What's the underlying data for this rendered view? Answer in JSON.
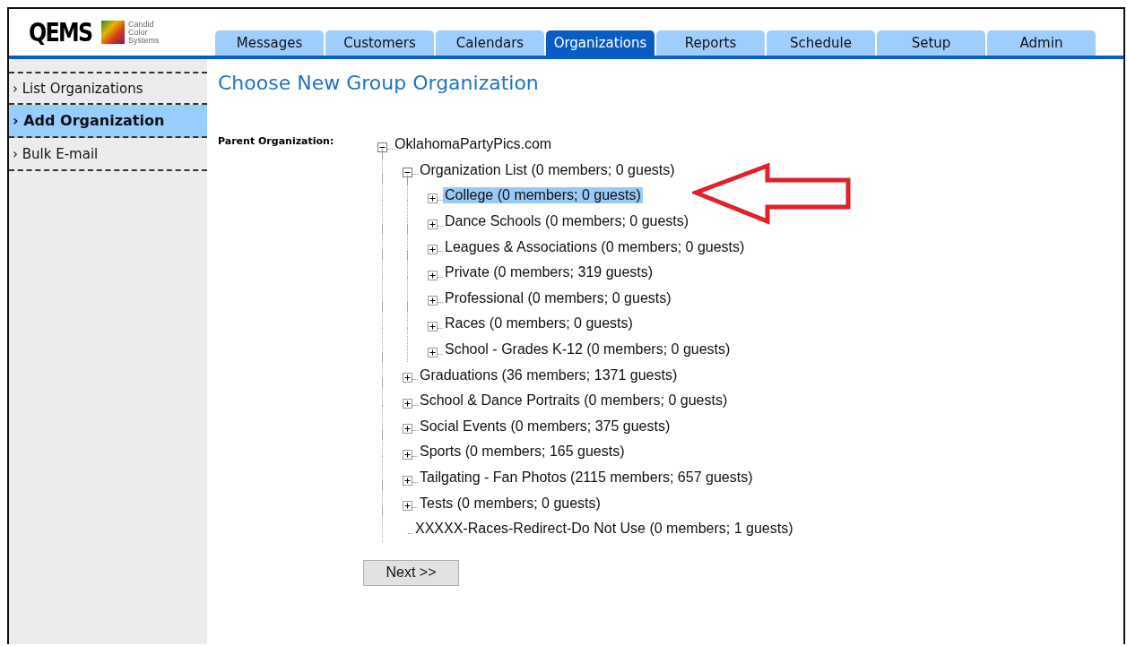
{
  "logo": {
    "name": "QEMS",
    "tagline": [
      "Candid",
      "Color",
      "Systems"
    ]
  },
  "tabs": [
    {
      "label": "Messages",
      "selected": false
    },
    {
      "label": "Customers",
      "selected": false
    },
    {
      "label": "Calendars",
      "selected": false
    },
    {
      "label": "Organizations",
      "selected": true
    },
    {
      "label": "Reports",
      "selected": false
    },
    {
      "label": "Schedule",
      "selected": false
    },
    {
      "label": "Setup",
      "selected": false
    },
    {
      "label": "Admin",
      "selected": false
    }
  ],
  "sidebar": {
    "items": [
      {
        "label": "›",
        "text": "List Organizations",
        "selected": false
      },
      {
        "label": "›",
        "text": "Add Organization",
        "selected": true
      },
      {
        "label": "›",
        "text": "Bulk E-mail",
        "selected": false
      }
    ]
  },
  "page_title": "Choose New Group Organization",
  "parent_label": "Parent Organization:",
  "tree": [
    {
      "label": "OklahomaPartyPics.com",
      "kind": "branch",
      "expanded": true,
      "selected": false,
      "children": [
        {
          "label": "Organization List (0 members; 0 guests)",
          "kind": "branch",
          "expanded": true,
          "selected": false,
          "children": [
            {
              "label": "College (0 members; 0 guests)",
              "kind": "branch",
              "expanded": false,
              "selected": true
            },
            {
              "label": "Dance Schools (0 members; 0 guests)",
              "kind": "branch",
              "expanded": false,
              "selected": false
            },
            {
              "label": "Leagues & Associations (0 members; 0 guests)",
              "kind": "branch",
              "expanded": false,
              "selected": false
            },
            {
              "label": "Private (0 members; 319 guests)",
              "kind": "branch",
              "expanded": false,
              "selected": false
            },
            {
              "label": "Professional (0 members; 0 guests)",
              "kind": "branch",
              "expanded": false,
              "selected": false
            },
            {
              "label": "Races (0 members; 0 guests)",
              "kind": "branch",
              "expanded": false,
              "selected": false
            },
            {
              "label": "School - Grades K-12 (0 members; 0 guests)",
              "kind": "branch",
              "expanded": false,
              "selected": false
            }
          ]
        },
        {
          "label": "Graduations (36 members; 1371 guests)",
          "kind": "branch",
          "expanded": false,
          "selected": false
        },
        {
          "label": "School & Dance Portraits (0 members; 0 guests)",
          "kind": "branch",
          "expanded": false,
          "selected": false
        },
        {
          "label": "Social Events (0 members; 375 guests)",
          "kind": "branch",
          "expanded": false,
          "selected": false
        },
        {
          "label": "Sports (0 members; 165 guests)",
          "kind": "branch",
          "expanded": false,
          "selected": false
        },
        {
          "label": "Tailgating - Fan Photos (2115 members; 657 guests)",
          "kind": "branch",
          "expanded": false,
          "selected": false
        },
        {
          "label": "Tests (0 members; 0 guests)",
          "kind": "branch",
          "expanded": false,
          "selected": false
        },
        {
          "label": "XXXXX-Races-Redirect-Do Not Use (0 members; 1 guests)",
          "kind": "leaf",
          "selected": false
        }
      ]
    }
  ],
  "next_button": "Next >>"
}
